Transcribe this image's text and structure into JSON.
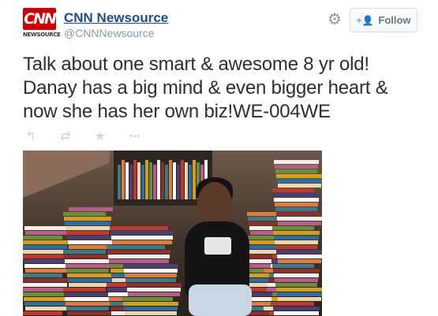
{
  "account": {
    "display_name": "CNN Newsource",
    "handle": "@CNNNewsource",
    "logo_text": "CNN",
    "logo_subtext": "NEWSOURCE"
  },
  "header": {
    "follow_label": "Follow",
    "follow_icon": "add-user-icon",
    "settings_icon": "gear-icon"
  },
  "tweet": {
    "text": "Talk about one smart & awesome 8 yr old! Danay has a big mind & even bigger heart & now she has her own biz!WE-004WE"
  },
  "actions": [
    {
      "icon": "reply-icon",
      "glyph": "↰"
    },
    {
      "icon": "retweet-icon",
      "glyph": "⇄"
    },
    {
      "icon": "favorite-icon",
      "glyph": "★"
    },
    {
      "icon": "more-icon",
      "glyph": "•••"
    }
  ],
  "colors": {
    "brand_red": "#cc0000",
    "link_blue": "#1a4f8b",
    "muted": "#8899a6",
    "action_gray": "#ccd6dd"
  }
}
